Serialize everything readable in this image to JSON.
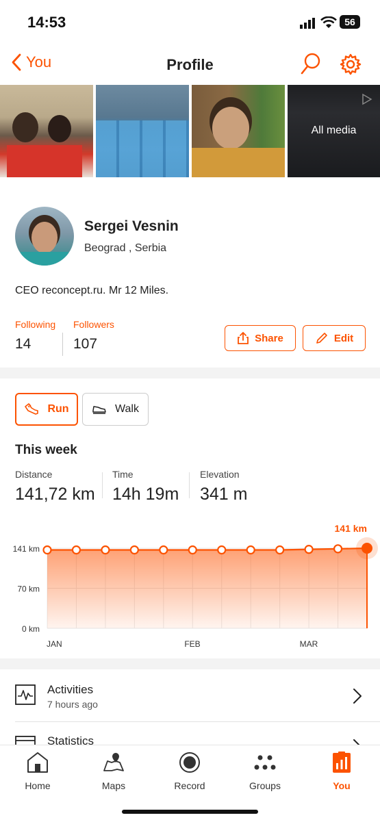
{
  "status": {
    "time": "14:53",
    "battery": "56"
  },
  "nav": {
    "back_label": "You",
    "title": "Profile"
  },
  "media": {
    "all_media_label": "All media"
  },
  "profile": {
    "name": "Sergei Vesnin",
    "location": "Beograd , Serbia",
    "bio": "CEO reconcept.ru. Mr 12 Miles.",
    "following_label": "Following",
    "following_count": "14",
    "followers_label": "Followers",
    "followers_count": "107",
    "share_label": "Share",
    "edit_label": "Edit"
  },
  "activity_tabs": {
    "run_label": "Run",
    "walk_label": "Walk"
  },
  "week": {
    "heading": "This week",
    "distance_label": "Distance",
    "distance_value": "141,72 km",
    "time_label": "Time",
    "time_value": "14h 19m",
    "elevation_label": "Elevation",
    "elevation_value": "341 m"
  },
  "chart_data": {
    "type": "area",
    "x": [
      "w1",
      "w2",
      "w3",
      "w4",
      "w5",
      "w6",
      "w7",
      "w8",
      "w9",
      "w10",
      "w11",
      "w12"
    ],
    "x_tick_labels": [
      "JAN",
      "FEB",
      "MAR"
    ],
    "y_tick_labels": [
      "141 km",
      "70 km",
      "0 km"
    ],
    "values": [
      138,
      138,
      138,
      138,
      138,
      138,
      138,
      138,
      138,
      139,
      140,
      141
    ],
    "ylim": [
      0,
      141
    ],
    "highlight_label": "141 km",
    "color": "#fc5200"
  },
  "list": {
    "activities_title": "Activities",
    "activities_subtitle": "7 hours ago",
    "statistics_title": "Statistics"
  },
  "tabbar": {
    "home": "Home",
    "maps": "Maps",
    "record": "Record",
    "groups": "Groups",
    "you": "You"
  },
  "colors": {
    "accent": "#fc5200",
    "text": "#242428",
    "divider": "#f3f3f3"
  }
}
